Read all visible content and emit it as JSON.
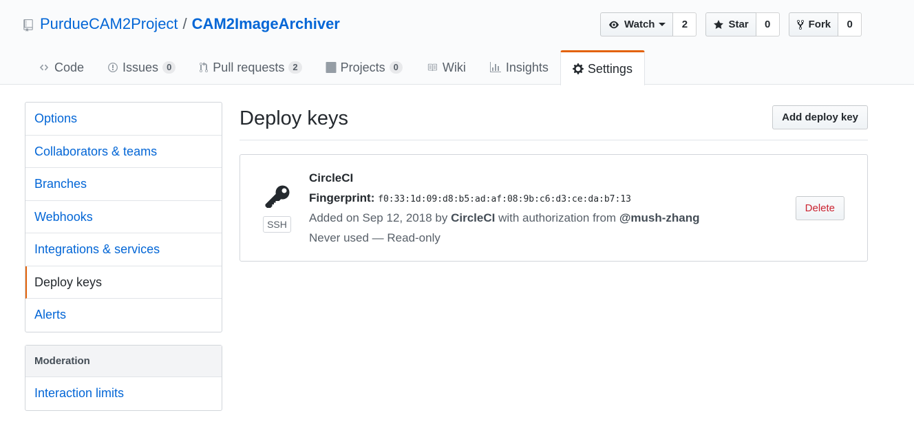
{
  "repo": {
    "owner": "PurdueCAM2Project",
    "separator": "/",
    "name": "CAM2ImageArchiver"
  },
  "actions": {
    "watch_label": "Watch",
    "watch_count": "2",
    "star_label": "Star",
    "star_count": "0",
    "fork_label": "Fork",
    "fork_count": "0"
  },
  "tabs": [
    {
      "label": "Code",
      "icon": "code-icon"
    },
    {
      "label": "Issues",
      "count": "0",
      "icon": "issue-icon"
    },
    {
      "label": "Pull requests",
      "count": "2",
      "icon": "pull-request-icon"
    },
    {
      "label": "Projects",
      "count": "0",
      "icon": "project-icon"
    },
    {
      "label": "Wiki",
      "icon": "book-icon"
    },
    {
      "label": "Insights",
      "icon": "graph-icon"
    },
    {
      "label": "Settings",
      "icon": "gear-icon",
      "selected": true
    }
  ],
  "sidebar": {
    "items": [
      {
        "label": "Options"
      },
      {
        "label": "Collaborators & teams"
      },
      {
        "label": "Branches"
      },
      {
        "label": "Webhooks"
      },
      {
        "label": "Integrations & services"
      },
      {
        "label": "Deploy keys"
      },
      {
        "label": "Alerts"
      }
    ],
    "moderation_heading": "Moderation",
    "moderation_items": [
      {
        "label": "Interaction limits"
      }
    ]
  },
  "main": {
    "title": "Deploy keys",
    "add_button": "Add deploy key",
    "key": {
      "title": "CircleCI",
      "type_label": "SSH",
      "fingerprint_label": "Fingerprint:",
      "fingerprint": "f0:33:1d:09:d8:b5:ad:af:08:9b:c6:d3:ce:da:b7:13",
      "added_prefix": "Added on Sep 12, 2018 by",
      "added_by": "CircleCI",
      "auth_prefix": "with authorization from",
      "auth_user": "@mush-zhang",
      "usage": "Never used — Read-only",
      "delete_label": "Delete"
    }
  },
  "colors": {
    "link": "#0366d6",
    "accent": "#e36209",
    "danger": "#cb2431"
  }
}
